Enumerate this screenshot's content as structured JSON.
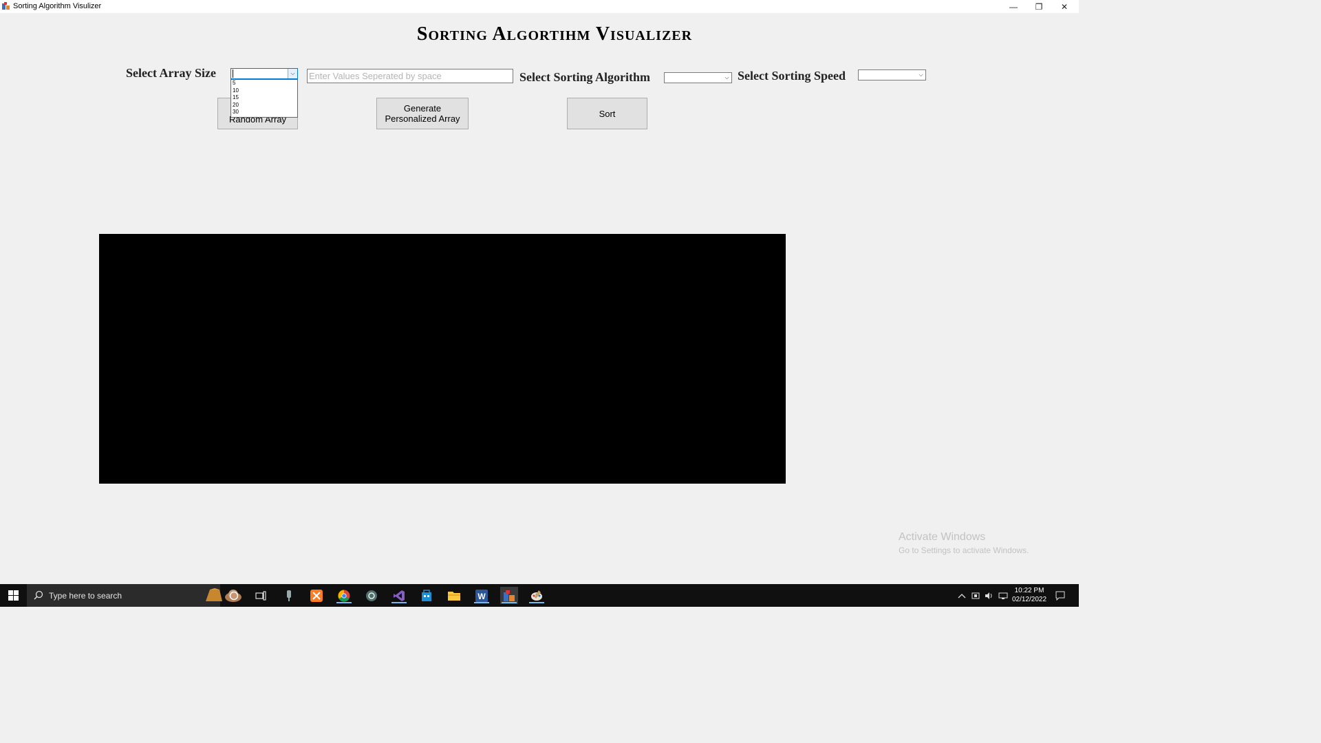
{
  "window": {
    "title": "Sorting Algorithm Visulizer",
    "controls": {
      "minimize": "—",
      "restore": "❐",
      "close": "✕"
    }
  },
  "heading": "Sorting Algortihm Visualizer",
  "array_size": {
    "label": "Select Array Size",
    "value": "",
    "options": [
      "5",
      "10",
      "15",
      "20",
      "30"
    ]
  },
  "values_input": {
    "placeholder": "Enter Values Seperated by space",
    "value": ""
  },
  "algorithm": {
    "label": "Select Sorting Algorithm",
    "value": ""
  },
  "speed": {
    "label": "Select Sorting Speed",
    "value": ""
  },
  "buttons": {
    "random": "Random Array",
    "personalized_line1": "Generate",
    "personalized_line2": "Personalized Array",
    "sort": "Sort"
  },
  "visualizer": {
    "background": "#000000"
  },
  "watermark": {
    "line1": "Activate Windows",
    "line2": "Go to Settings to activate Windows."
  },
  "taskbar": {
    "search_placeholder": "Type here to search",
    "clock_time": "10:22 PM",
    "clock_date": "02/12/2022",
    "apps": [
      "cortana-icon",
      "task-view-icon",
      "voice-recorder-icon",
      "xampp-icon",
      "chrome-icon",
      "app-icon",
      "visual-studio-icon",
      "store-icon",
      "file-explorer-icon",
      "word-icon",
      "sorting-visualizer-app-icon",
      "paint-icon"
    ]
  },
  "colors": {
    "accent": "#0078d7",
    "taskbar": "#101010",
    "chrome": "#db4437",
    "xampp": "#fb7a24",
    "vs": "#865fc5",
    "word": "#2b579a"
  }
}
